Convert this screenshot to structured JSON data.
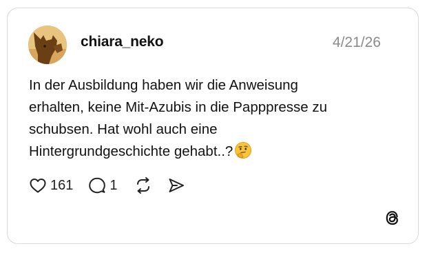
{
  "post": {
    "username": "chiara_neko",
    "date": "4/21/26",
    "text": "In der Ausbildung haben wir die Anweisung\nerhalten, keine Mit-Azubis in die Papppresse zu\nschubsen. Hat wohl auch eine\nHintergrundgeschichte gehabt..?",
    "emoji": "thinking-face-emoji"
  },
  "actions": {
    "likes": "161",
    "replies": "1"
  },
  "icons": {
    "like": "heart-icon",
    "reply": "speech-bubble-icon",
    "repost": "repost-icon",
    "share": "send-icon",
    "brand": "threads-logo-icon"
  },
  "colors": {
    "border": "#d9d9d9",
    "text": "#111111",
    "muted": "#8a8a8a",
    "avatar_bg": "#e9c47f",
    "avatar_fg": "#6b3f14"
  }
}
